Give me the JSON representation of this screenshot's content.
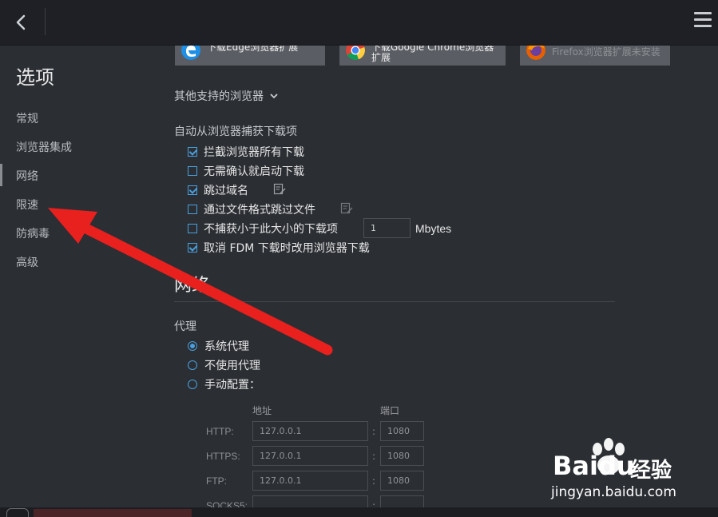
{
  "sidebar": {
    "title": "选项",
    "items": [
      {
        "label": "常规"
      },
      {
        "label": "浏览器集成"
      },
      {
        "label": "网络"
      },
      {
        "label": "限速"
      },
      {
        "label": "防病毒"
      },
      {
        "label": "高级"
      }
    ],
    "active_item": "网络"
  },
  "extensions": {
    "edge_label": "下载Edge浏览器扩展",
    "chrome_label": "下载Google Chrome浏览器扩展",
    "firefox_label": "Firefox浏览器扩展未安装"
  },
  "browser_integration": {
    "other_browsers_label": "其他支持的浏览器",
    "capture_label": "自动从浏览器捕获下载项",
    "options": [
      {
        "label": "拦截浏览器所有下载",
        "checked": true
      },
      {
        "label": "无需确认就启动下载",
        "checked": false
      },
      {
        "label": "跳过域名",
        "checked": true
      },
      {
        "label": "通过文件格式跳过文件",
        "checked": false
      },
      {
        "label": "不捕获小于此大小的下载项",
        "checked": false
      },
      {
        "label": "取消 FDM 下载时改用浏览器下载",
        "checked": true
      }
    ],
    "min_size_value": "1",
    "min_size_unit": "Mbytes"
  },
  "network": {
    "heading": "网络",
    "proxy_label": "代理",
    "proxy_options": [
      {
        "label": "系统代理",
        "selected": true
      },
      {
        "label": "不使用代理",
        "selected": false
      },
      {
        "label": "手动配置：",
        "selected": false
      }
    ],
    "address_header": "地址",
    "port_header": "端口",
    "rows": [
      {
        "protocol": "HTTP:",
        "address": "127.0.0.1",
        "port": "1080"
      },
      {
        "protocol": "HTTPS:",
        "address": "127.0.0.1",
        "port": "1080"
      },
      {
        "protocol": "FTP:",
        "address": "127.0.0.1",
        "port": "1080"
      },
      {
        "protocol": "SOCKS5:",
        "address": "",
        "port": ""
      }
    ]
  },
  "watermark": {
    "logo": "Baidu",
    "cn": "经验",
    "url": "jingyan.baidu.com"
  },
  "colors": {
    "accent": "#4a9fdc",
    "annotation_arrow": "#e8201e",
    "background": "#2b2e33",
    "topbar": "#1e2025"
  }
}
